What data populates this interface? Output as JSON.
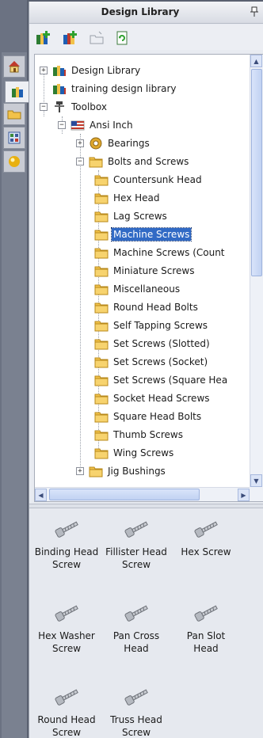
{
  "panel": {
    "title": "Design Library"
  },
  "side_tabs": [
    {
      "icon": "home-icon"
    },
    {
      "icon": "design-library-icon"
    },
    {
      "icon": "file-explorer-icon"
    },
    {
      "icon": "view-palette-icon"
    },
    {
      "icon": "appearances-icon"
    }
  ],
  "toolbar": {
    "buttons": [
      {
        "icon": "add-to-library-icon"
      },
      {
        "icon": "add-file-location-icon"
      },
      {
        "icon": "create-new-folder-icon"
      },
      {
        "icon": "refresh-icon"
      }
    ]
  },
  "tree": {
    "items": [
      {
        "label": "Design Library",
        "icon": "library-icon"
      },
      {
        "label": "training design library",
        "icon": "library-icon"
      },
      {
        "label": "Toolbox",
        "icon": "toolbox-icon"
      },
      {
        "label": "Ansi Inch",
        "icon": "us-flag-icon"
      },
      {
        "label": "Bearings",
        "icon": "bearing-icon"
      },
      {
        "label": "Bolts and Screws",
        "icon": "folder-icon"
      },
      {
        "label": "Countersunk Head",
        "icon": "folder-icon"
      },
      {
        "label": "Hex Head",
        "icon": "folder-icon"
      },
      {
        "label": "Lag Screws",
        "icon": "folder-icon"
      },
      {
        "label": "Machine Screws",
        "icon": "folder-icon"
      },
      {
        "label": "Machine Screws (Count",
        "icon": "folder-icon"
      },
      {
        "label": "Miniature Screws",
        "icon": "folder-icon"
      },
      {
        "label": "Miscellaneous",
        "icon": "folder-icon"
      },
      {
        "label": "Round Head Bolts",
        "icon": "folder-icon"
      },
      {
        "label": "Self Tapping Screws",
        "icon": "folder-icon"
      },
      {
        "label": "Set Screws (Slotted)",
        "icon": "folder-icon"
      },
      {
        "label": "Set Screws (Socket)",
        "icon": "folder-icon"
      },
      {
        "label": "Set Screws (Square Hea",
        "icon": "folder-icon"
      },
      {
        "label": "Socket Head Screws",
        "icon": "folder-icon"
      },
      {
        "label": "Square Head Bolts",
        "icon": "folder-icon"
      },
      {
        "label": "Thumb Screws",
        "icon": "folder-icon"
      },
      {
        "label": "Wing Screws",
        "icon": "folder-icon"
      },
      {
        "label": "Jig Bushings",
        "icon": "folder-icon"
      }
    ],
    "selected": "Machine Screws"
  },
  "files": {
    "items": [
      {
        "line1": "Binding Head",
        "line2": "Screw"
      },
      {
        "line1": "Fillister Head",
        "line2": "Screw"
      },
      {
        "line1": "Hex Screw",
        "line2": ""
      },
      {
        "line1": "Hex Washer",
        "line2": "Screw"
      },
      {
        "line1": "Pan Cross",
        "line2": "Head"
      },
      {
        "line1": "Pan Slot",
        "line2": "Head"
      },
      {
        "line1": "Round Head",
        "line2": "Screw"
      },
      {
        "line1": "Truss Head",
        "line2": "Screw"
      }
    ]
  },
  "colors": {
    "selection": "#316ac5",
    "folder": "#f2c24a",
    "panel_bg": "#e8ebf1"
  }
}
